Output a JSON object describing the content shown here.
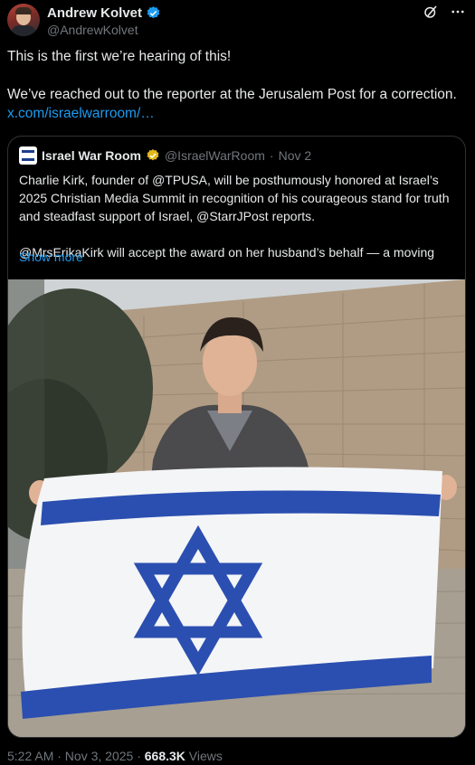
{
  "author": {
    "name": "Andrew Kolvet",
    "handle": "@AndrewKolvet"
  },
  "tweet": {
    "line1": "This is the first we’re hearing of this!",
    "line2": "We’ve reached out to the reporter at the Jerusalem Post for a correction.",
    "link": "x.com/israelwarroom/…"
  },
  "quoted": {
    "name": "Israel War Room",
    "handle": "@IsraelWarRoom",
    "separator": "·",
    "date": "Nov 2",
    "paragraph1": "Charlie Kirk, founder of @TPUSA, will be posthumously honored at Israel’s 2025 Christian Media Summit in recognition of his courageous stand for truth and steadfast support of Israel, @StarrJPost reports.",
    "paragraph2": "@MrsErikaKirk will accept the award on her husband’s behalf — a moving",
    "show_more": "Show more"
  },
  "meta": {
    "time": "5:22 AM · Nov 3, 2025 ·",
    "views_count": "668.3K",
    "views_label": "Views"
  },
  "colors": {
    "accent": "#1d9bf0",
    "verified_gold": "#e2b719",
    "flag_blue": "#2b4fb0"
  },
  "icons": [
    "verified-badge-icon",
    "grok-icon",
    "more-options-icon",
    "gold-verified-badge-icon"
  ]
}
